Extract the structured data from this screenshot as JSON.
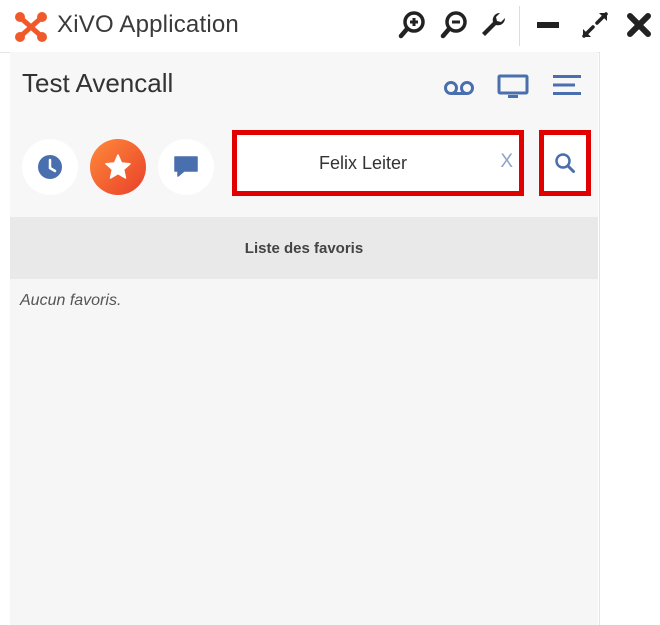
{
  "window": {
    "title": "XiVO Application",
    "icons": [
      "zoom-in-icon",
      "zoom-out-icon",
      "wrench-icon",
      "minimize-icon",
      "maximize-icon",
      "close-icon"
    ]
  },
  "header": {
    "user_name": "Test Avencall",
    "icons": [
      "voicemail-icon",
      "monitor-icon",
      "menu-icon"
    ]
  },
  "tabs": [
    {
      "icon": "clock-icon",
      "active": false
    },
    {
      "icon": "star-icon",
      "active": true
    },
    {
      "icon": "chat-icon",
      "active": false
    }
  ],
  "search": {
    "value": "Felix Leiter",
    "clear_label": "X"
  },
  "favorites": {
    "title": "Liste des favoris",
    "empty_message": "Aucun favoris."
  },
  "colors": {
    "accent_blue": "#4a6fae",
    "highlight_red": "#e00000",
    "active_orange": "#f05a2a"
  }
}
